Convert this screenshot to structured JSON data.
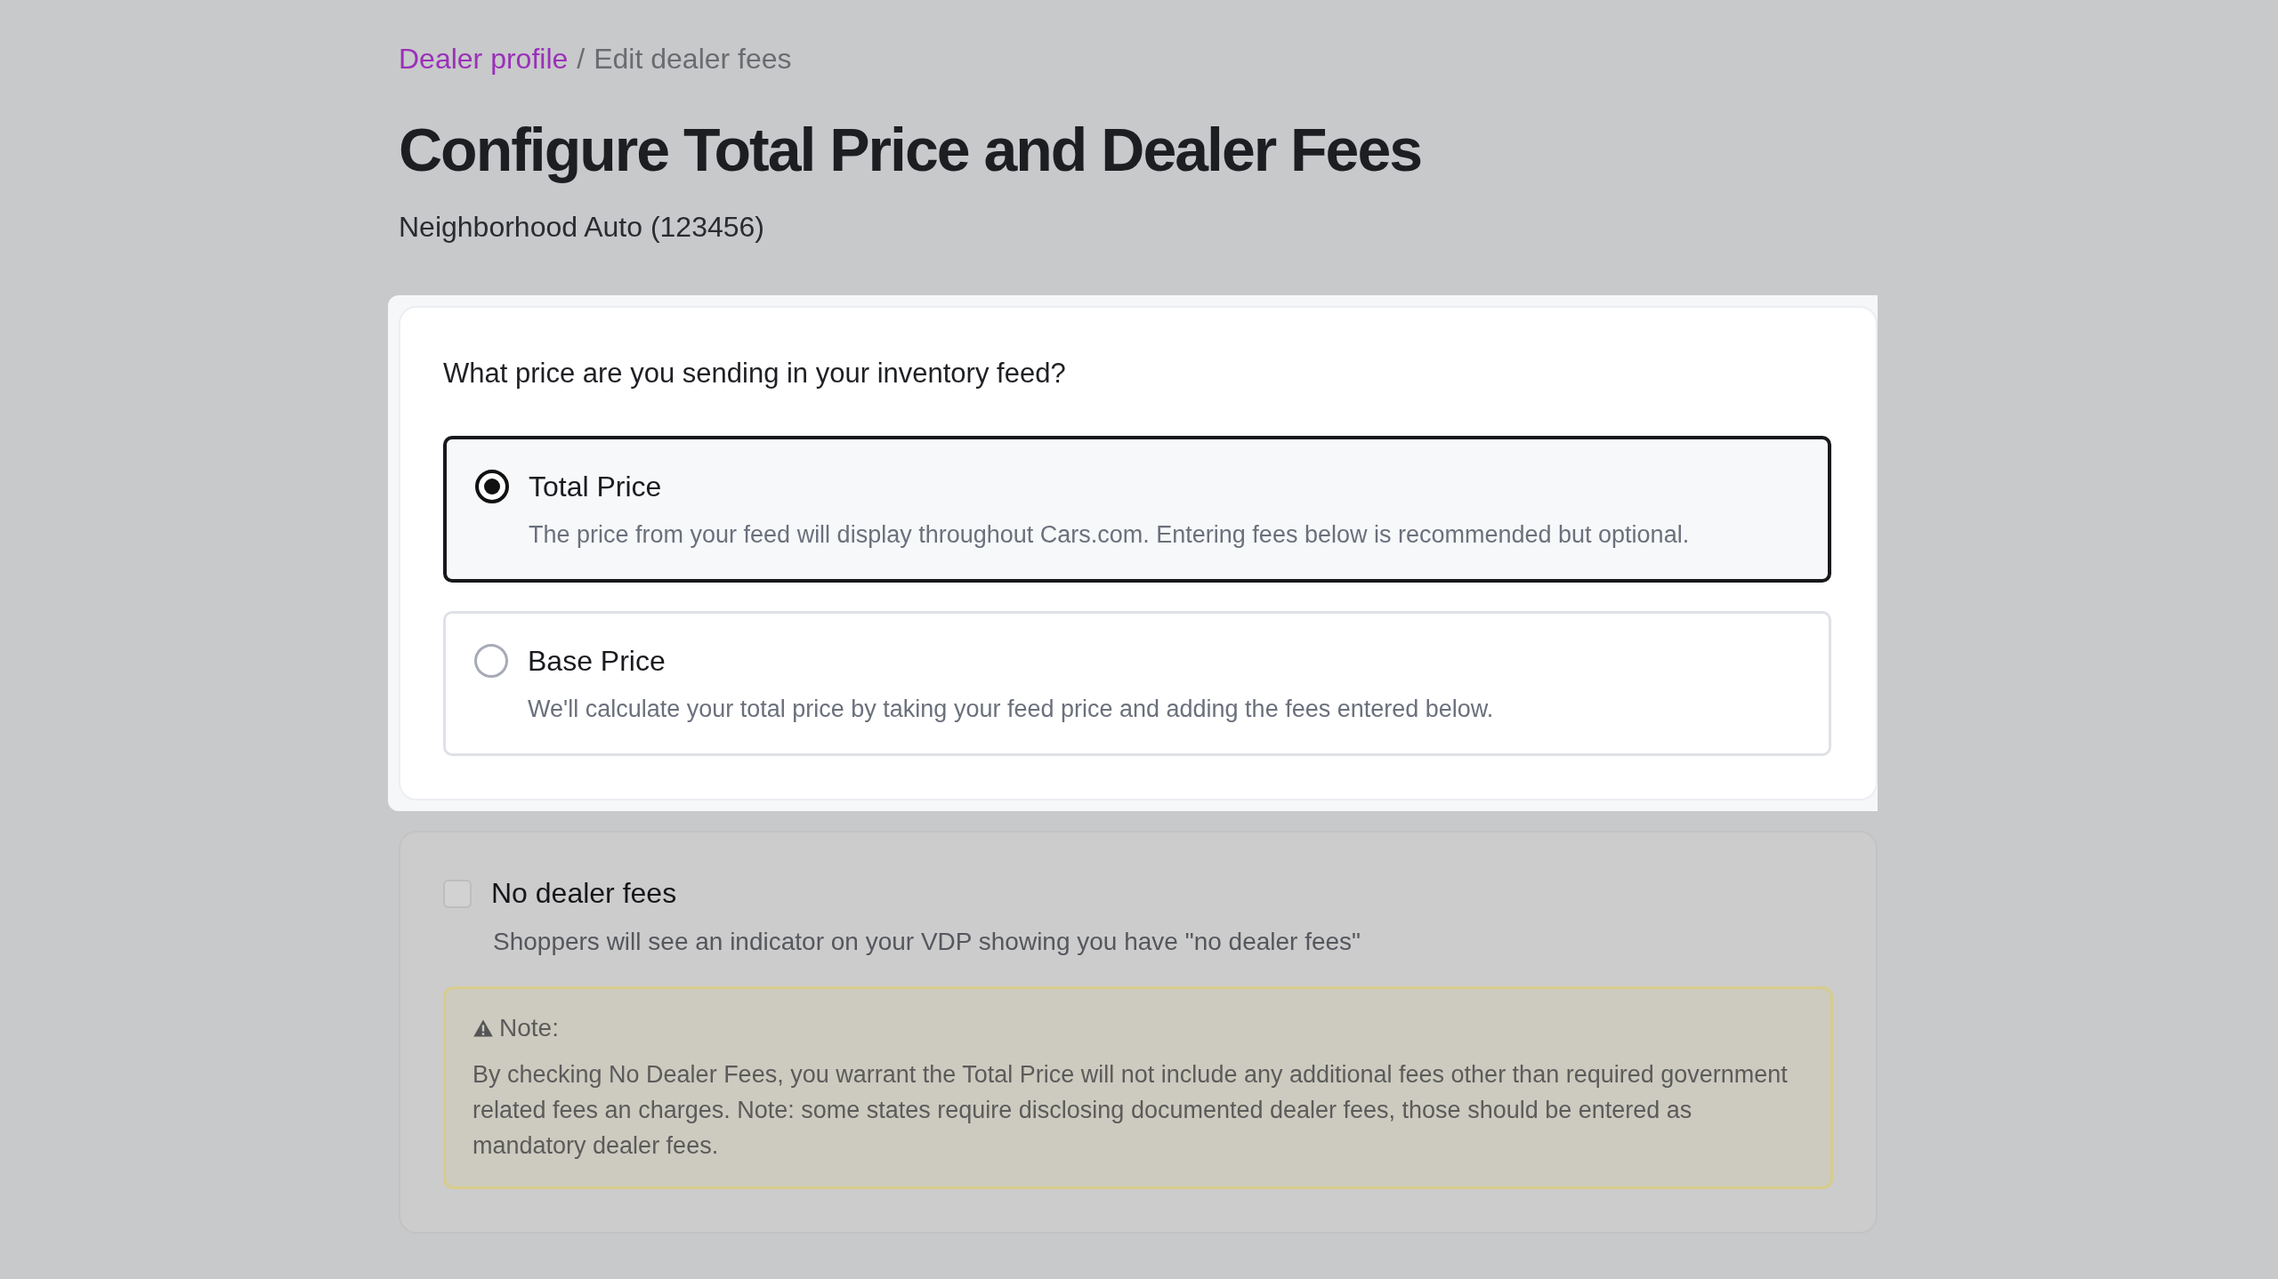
{
  "breadcrumb": {
    "link": "Dealer profile",
    "separator": "/",
    "current": "Edit dealer fees"
  },
  "title": "Configure Total Price and Dealer Fees",
  "subtitle": "Neighborhood Auto (123456)",
  "price_question": "What price are you sending in your inventory feed?",
  "price_options": [
    {
      "label": "Total Price",
      "description": "The price from your feed will display throughout Cars.com. Entering fees below is recommended but optional.",
      "selected": true
    },
    {
      "label": "Base Price",
      "description": "We'll calculate your total price by taking your feed price and adding the fees entered below.",
      "selected": false
    }
  ],
  "no_fees": {
    "label": "No dealer fees",
    "checked": false,
    "description": "Shoppers will see an indicator on your VDP showing you have \"no dealer fees\""
  },
  "note": {
    "heading": "Note:",
    "text": "By checking No Dealer Fees, you warrant the Total Price will not include any additional fees other than required government related fees an charges. Note: some states require disclosing documented dealer fees, those should be entered as mandatory dealer fees."
  }
}
